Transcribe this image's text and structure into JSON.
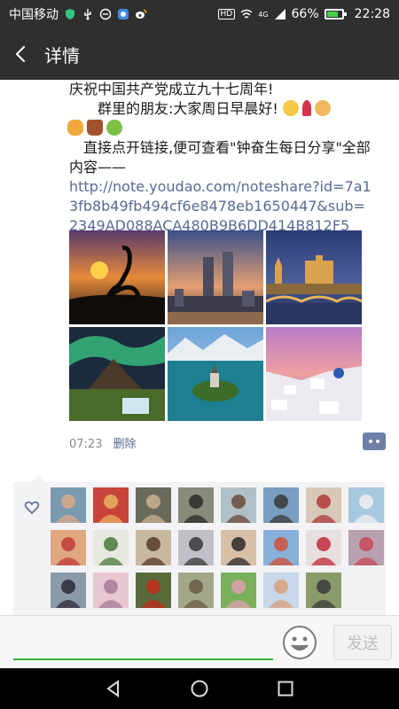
{
  "status_bar": {
    "carrier": "中国移动",
    "battery": "66%",
    "time": "22:28",
    "signal_badge": "4G",
    "hd_badge": "HD",
    "battery_level": 0.66,
    "icons": [
      "shield-icon",
      "usb-icon",
      "notification-icon",
      "app-icon",
      "weibo-icon",
      "wifi-icon",
      "signal-icon",
      "battery-icon"
    ]
  },
  "header": {
    "title": "详情",
    "back_icon": "back-arrow-icon"
  },
  "post": {
    "line1": "庆祝中国共产党成立九十七周年!",
    "line2": "群里的朋友:大家周日早晨好!",
    "line2_emojis": [
      "smile-emoji",
      "rose-emoji",
      "handshake-emoji"
    ],
    "line3_emojis": [
      "clap-emoji",
      "coffee-emoji",
      "blessing-emoji"
    ],
    "line4": "直接点开链接,便可查看\"钟奋生每日分享\"全部内容——",
    "link": "http://note.youdao.com/noteshare?id=7a13fb8b49fb494cf6e8478eb1650447&sub=2349AD088ACA480B9B6DD414B812F5",
    "photos": [
      "sunset-heron-photo",
      "city-skyline-photo",
      "castle-river-photo",
      "aurora-mountain-photo",
      "lake-island-photo",
      "santorini-photo"
    ],
    "time": "07:23",
    "delete_label": "删除",
    "comment_icon": "comment-dots-icon"
  },
  "likes": {
    "heart_icon": "heart-outline-icon",
    "avatars": [
      "avatar-1",
      "avatar-2",
      "avatar-3",
      "avatar-4",
      "avatar-5",
      "avatar-6",
      "avatar-7",
      "avatar-8",
      "avatar-9",
      "avatar-10",
      "avatar-11",
      "avatar-12",
      "avatar-13",
      "avatar-14",
      "avatar-15",
      "avatar-16",
      "avatar-17",
      "avatar-18",
      "avatar-19",
      "avatar-20",
      "avatar-21",
      "avatar-22",
      "avatar-23"
    ]
  },
  "input_bar": {
    "placeholder": "",
    "send_label": "发送",
    "accent_color": "#3cb035"
  },
  "colors": {
    "header_bg": "#2f2f2f",
    "link": "#576b95",
    "likes_bg": "#f3f3f5"
  }
}
